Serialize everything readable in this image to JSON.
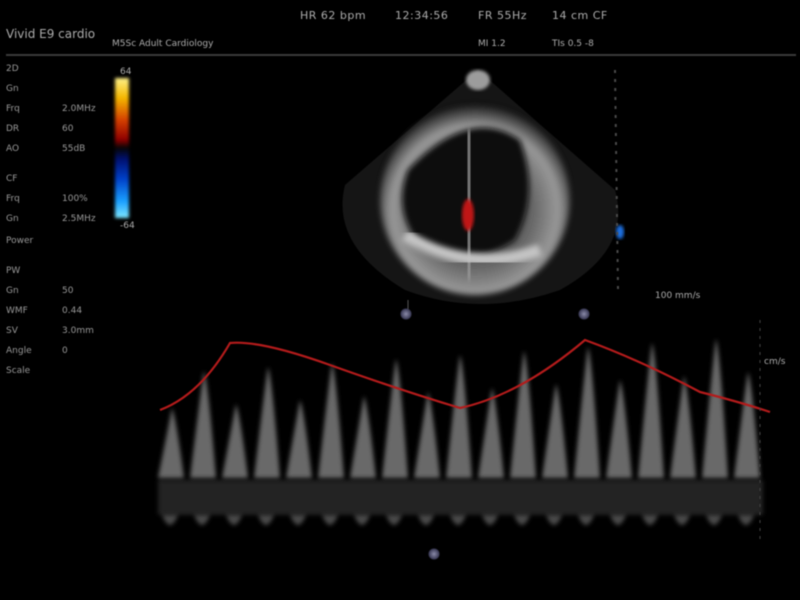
{
  "header": {
    "app_name": "Vivid E9 cardio",
    "probe": "M5Sc  Adult  Cardiology",
    "items": [
      "HR 62 bpm",
      "12:34:56",
      "FR 55Hz",
      "14 cm  CF",
      "MI 1.2",
      "TIs 0.5  -8"
    ]
  },
  "params": {
    "left_labels": [
      "2D",
      "Gn",
      "Frq",
      "DR",
      "AO",
      "CF",
      "Frq",
      "Gn",
      "Power",
      "PW",
      "Gn",
      "WMF",
      "SV",
      "Angle",
      "Scale"
    ],
    "left_values": [
      "2.0MHz",
      "60",
      "55dB",
      "100%",
      "2.5MHz",
      "50",
      "0.44",
      "3.0mm",
      "0"
    ]
  },
  "colorbar": {
    "top_label": "64",
    "bottom_label": "-64"
  },
  "doppler": {
    "speed_label": "100 mm/s",
    "scale_label": "cm/s"
  },
  "colors": {
    "ecg": "#b31b1b",
    "background": "#000000"
  }
}
